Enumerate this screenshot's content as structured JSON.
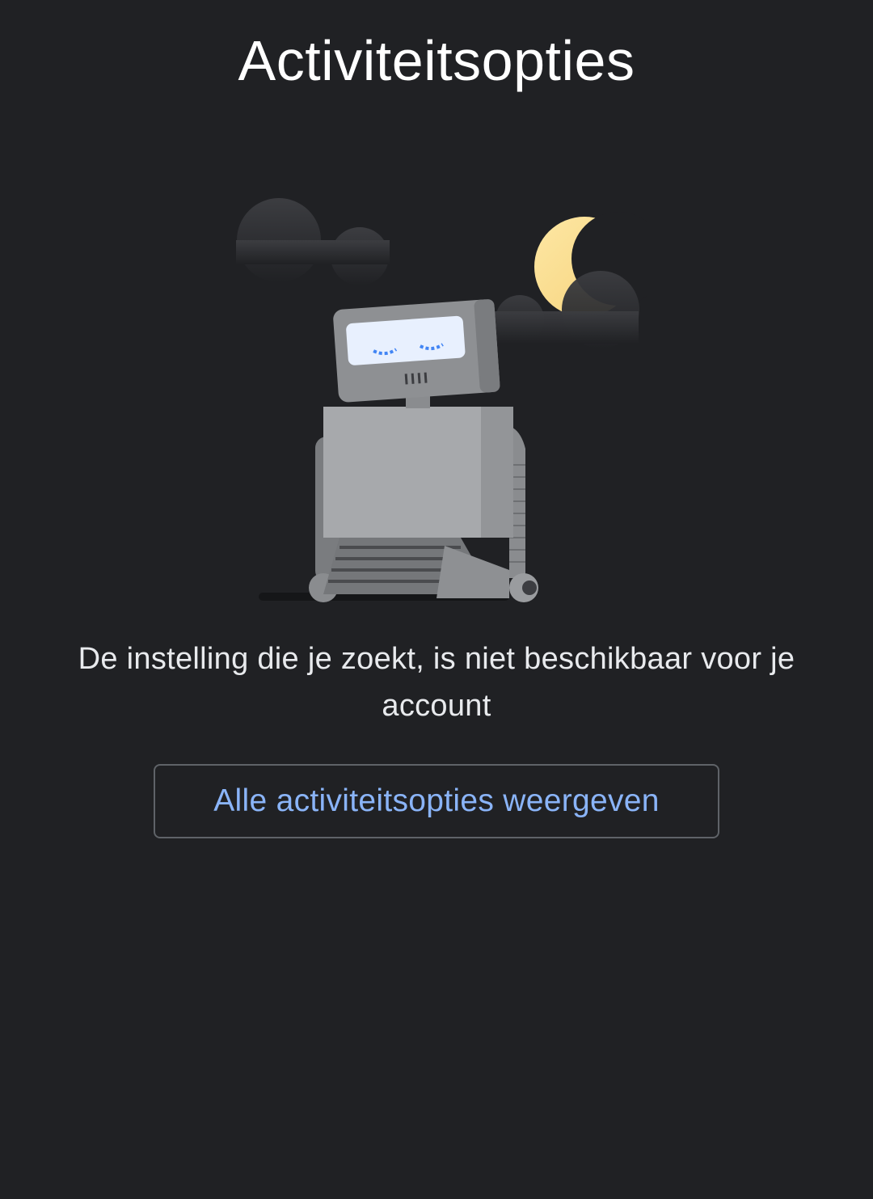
{
  "header": {
    "title": "Activiteitsopties"
  },
  "illustration": {
    "icon": "sleeping-robot-illustration"
  },
  "main": {
    "message": "De instelling die je zoekt, is niet beschikbaar voor je account",
    "button_label": "Alle activiteitsopties weergeven"
  },
  "colors": {
    "background": "#202124",
    "accent": "#8ab4f8",
    "button_border": "#5f6368",
    "moon": "#fde293"
  }
}
